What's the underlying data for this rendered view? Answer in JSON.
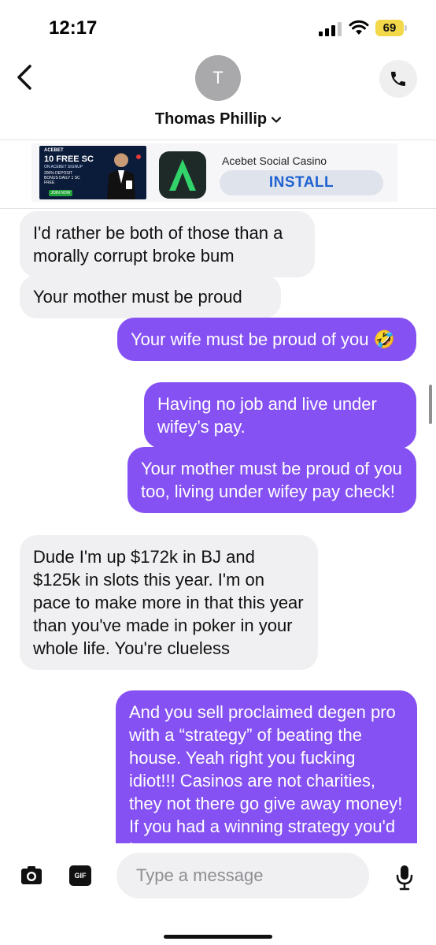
{
  "status_bar": {
    "time": "12:17",
    "battery": "69"
  },
  "header": {
    "avatar_initial": "T",
    "contact_name": "Thomas Phillip"
  },
  "ad": {
    "image": {
      "brand": "ACEBET",
      "headline": "10 FREE SC",
      "subline": "ON ACEBET SIGNUP",
      "promo_left": "200% DEPOSIT BONUS",
      "promo_right": "DAILY 1 SC FREE",
      "cta": "JOIN NOW"
    },
    "app_name": "Acebet Social Casino",
    "install_label": "INSTALL"
  },
  "messages": [
    {
      "dir": "in",
      "text": "I'd rather be both of those than a morally corrupt broke bum"
    },
    {
      "dir": "in",
      "text": "Your mother must be proud"
    },
    {
      "dir": "out",
      "text": "Your wife must be proud of you 🤣"
    },
    {
      "dir": "out",
      "text": "Having no job and live under wifey’s pay."
    },
    {
      "dir": "out",
      "text": "Your mother must be proud of you too, living under wifey pay check!"
    },
    {
      "dir": "in",
      "text": "Dude I'm up $172k in BJ and $125k in slots this year. I'm on pace to make more in that this year than you've made in poker in your whole life. You're clueless"
    },
    {
      "dir": "out",
      "text": "And you sell proclaimed degen pro with a “strategy” of beating the house. Yeah right you fucking idiot!!! Casinos are not charities, they not there go give away money! If you had a winning strategy you'd be"
    }
  ],
  "composer": {
    "placeholder": "Type a message",
    "gif_label": "GIF"
  },
  "colors": {
    "outgoing_bubble": "#8551f2",
    "incoming_bubble": "#f0f0f2",
    "install_text": "#1f62d1"
  }
}
